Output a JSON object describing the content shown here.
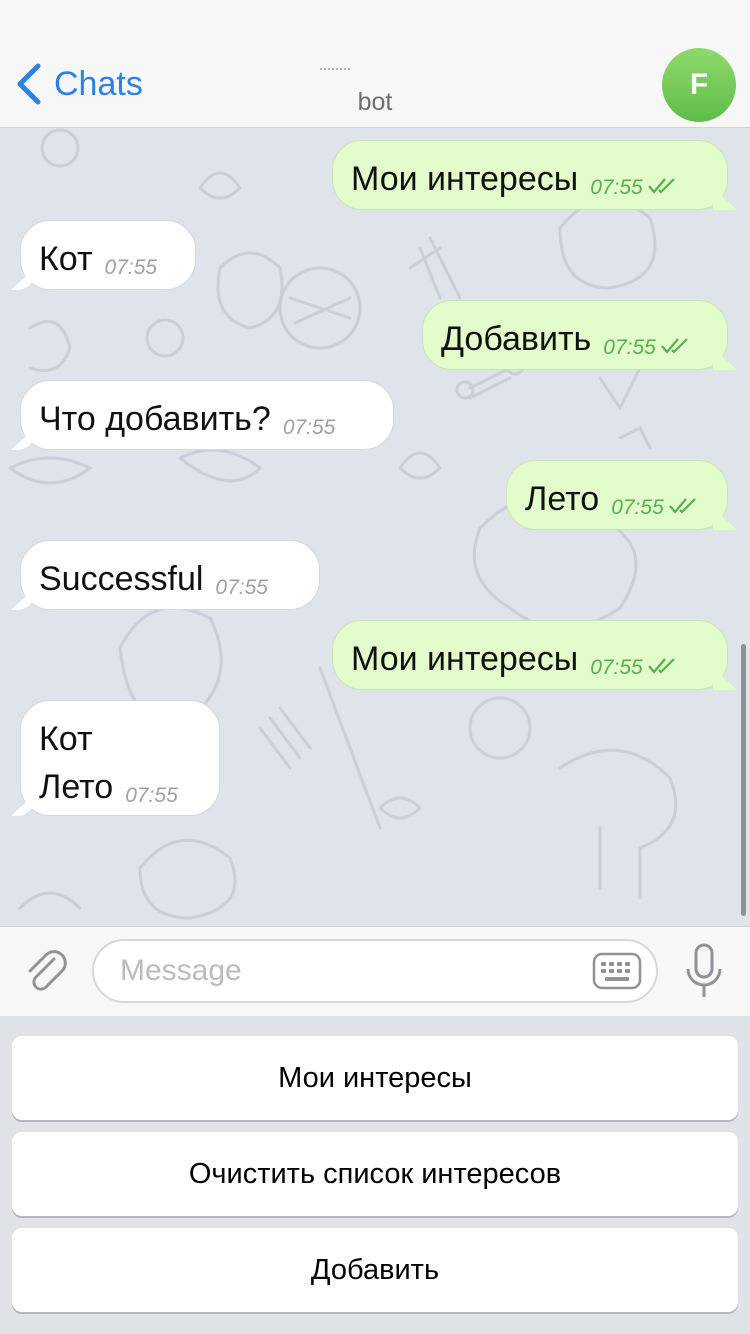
{
  "header": {
    "back_label": "Chats",
    "subtitle": "bot",
    "avatar_letter": "F"
  },
  "messages": [
    {
      "dir": "out",
      "text": "Мои интересы",
      "time": "07:55"
    },
    {
      "dir": "in",
      "text": "Кот",
      "time": "07:55"
    },
    {
      "dir": "out",
      "text": "Добавить",
      "time": "07:55"
    },
    {
      "dir": "in",
      "text": "Что добавить?",
      "time": "07:55"
    },
    {
      "dir": "out",
      "text": "Лето",
      "time": "07:55"
    },
    {
      "dir": "in",
      "text": "Successful",
      "time": "07:55"
    },
    {
      "dir": "out",
      "text": "Мои интересы",
      "time": "07:55"
    },
    {
      "dir": "in",
      "line1": "Кот",
      "text": "Лето",
      "time": "07:55"
    }
  ],
  "composer": {
    "placeholder": "Message"
  },
  "reply_keyboard": {
    "buttons": [
      "Мои интересы",
      "Очистить список интересов",
      "Добавить"
    ]
  },
  "colors": {
    "accent": "#2b82e4",
    "outgoing_bubble": "#e2fccb",
    "incoming_bubble": "#ffffff",
    "read_check": "#56b04f",
    "avatar": "#6ec753"
  }
}
